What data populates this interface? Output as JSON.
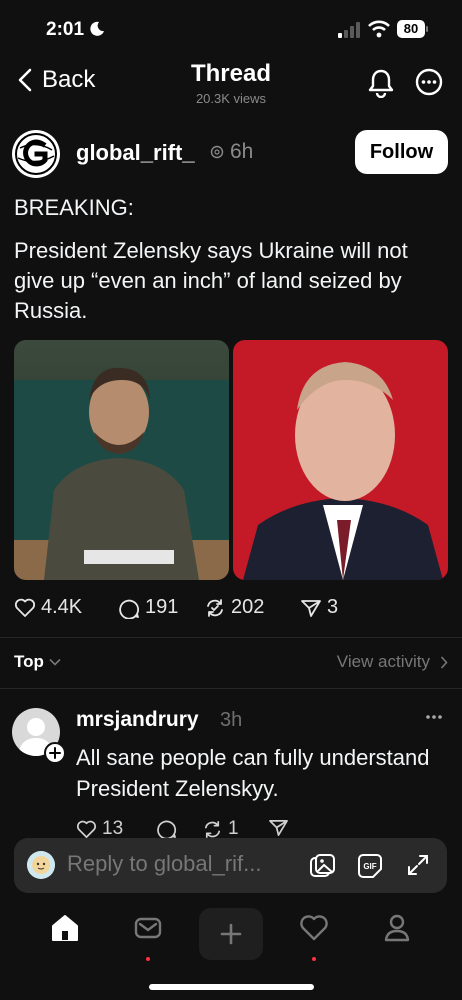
{
  "status_bar": {
    "time": "2:01",
    "battery": "80"
  },
  "header": {
    "back_label": "Back",
    "title": "Thread",
    "views": "20.3K views"
  },
  "post": {
    "username": "global_rift_",
    "time": "6h",
    "follow_label": "Follow",
    "line1": "BREAKING:",
    "body": "President Zelensky says Ukraine will not give up “even an inch” of land seized by Russia.",
    "stats": {
      "likes": "4.4K",
      "comments": "191",
      "reposts": "202",
      "shares": "3"
    }
  },
  "sort": {
    "label": "Top",
    "view_activity": "View activity"
  },
  "reply": {
    "username": "mrsjandrury",
    "time": "3h",
    "text": "All sane people can fully understand President Zelenskyy.",
    "likes": "13",
    "reposts": "1"
  },
  "composer": {
    "placeholder": "Reply to global_rif..."
  },
  "colors": {
    "background": "#101010",
    "accent_red": "#ff3040",
    "muted": "#8a8a8a"
  },
  "icons": [
    "moon-icon",
    "signal-icon",
    "wifi-icon",
    "battery-icon",
    "chevron-left-icon",
    "bell-icon",
    "more-icon",
    "activity-icon",
    "heart-icon",
    "comment-icon",
    "repost-icon",
    "share-icon",
    "chevron-down-icon",
    "chevron-right-icon",
    "image-icon",
    "gif-icon",
    "expand-icon",
    "home-icon",
    "inbox-icon",
    "plus-icon",
    "person-icon"
  ]
}
